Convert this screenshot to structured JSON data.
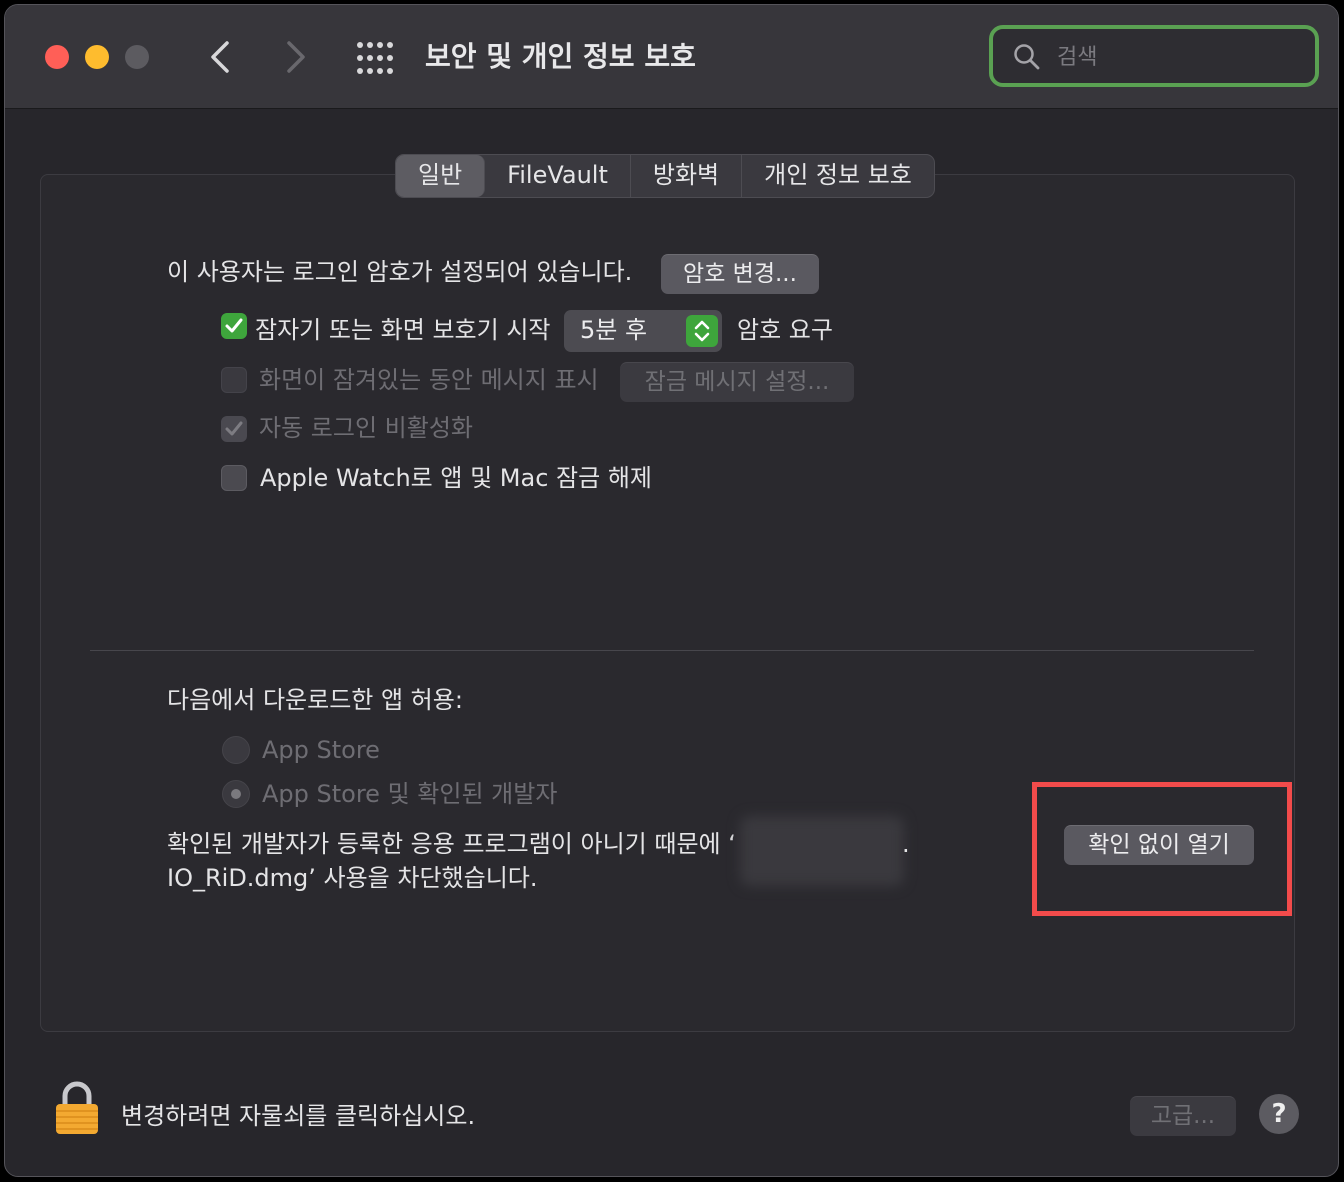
{
  "window": {
    "title": "보안 및 개인 정보 보호",
    "search": {
      "placeholder": "검색",
      "value": ""
    }
  },
  "tabs": [
    {
      "label": "일반",
      "active": true
    },
    {
      "label": "FileVault",
      "active": false
    },
    {
      "label": "방화벽",
      "active": false
    },
    {
      "label": "개인 정보 보호",
      "active": false
    }
  ],
  "general": {
    "password_text": "이 사용자는 로그인 암호가 설정되어 있습니다.",
    "change_password_button": "암호 변경...",
    "require_password": {
      "label": "잠자기 또는 화면 보호기 시작",
      "checked": true,
      "delay_value": "5분 후",
      "suffix": "암호 요구"
    },
    "show_message": {
      "label": "화면이 잠겨있는 동안 메시지 표시",
      "checked": false,
      "enabled": false
    },
    "lock_message_button": "잠금 메시지 설정...",
    "disable_auto_login": {
      "label": "자동 로그인 비활성화",
      "checked": true,
      "enabled": false
    },
    "apple_watch_unlock": {
      "label": "Apple Watch로 앱 및 Mac 잠금 해제",
      "checked": false,
      "enabled": true
    }
  },
  "downloads": {
    "heading": "다음에서 다운로드한 앱 허용:",
    "options": [
      {
        "label": "App Store",
        "selected": false
      },
      {
        "label": "App Store 및 확인된 개발자",
        "selected": true
      }
    ],
    "blocked_message_line1": "확인된 개발자가 등록한 응용 프로그램이 아니기 때문에 ‘",
    "blocked_message_line1_end": ".",
    "blocked_message_line2": "IO_RiD.dmg’ 사용을 차단했습니다.",
    "open_anyway_button": "확인 없이 열기"
  },
  "footer": {
    "lock_text": "변경하려면 자물쇠를 클릭하십시오.",
    "advanced_button": "고급...",
    "help_button": "?"
  },
  "colors": {
    "accent_green": "#3ea53c",
    "search_focus": "#5aa152",
    "highlight_red": "#f24b4b"
  }
}
